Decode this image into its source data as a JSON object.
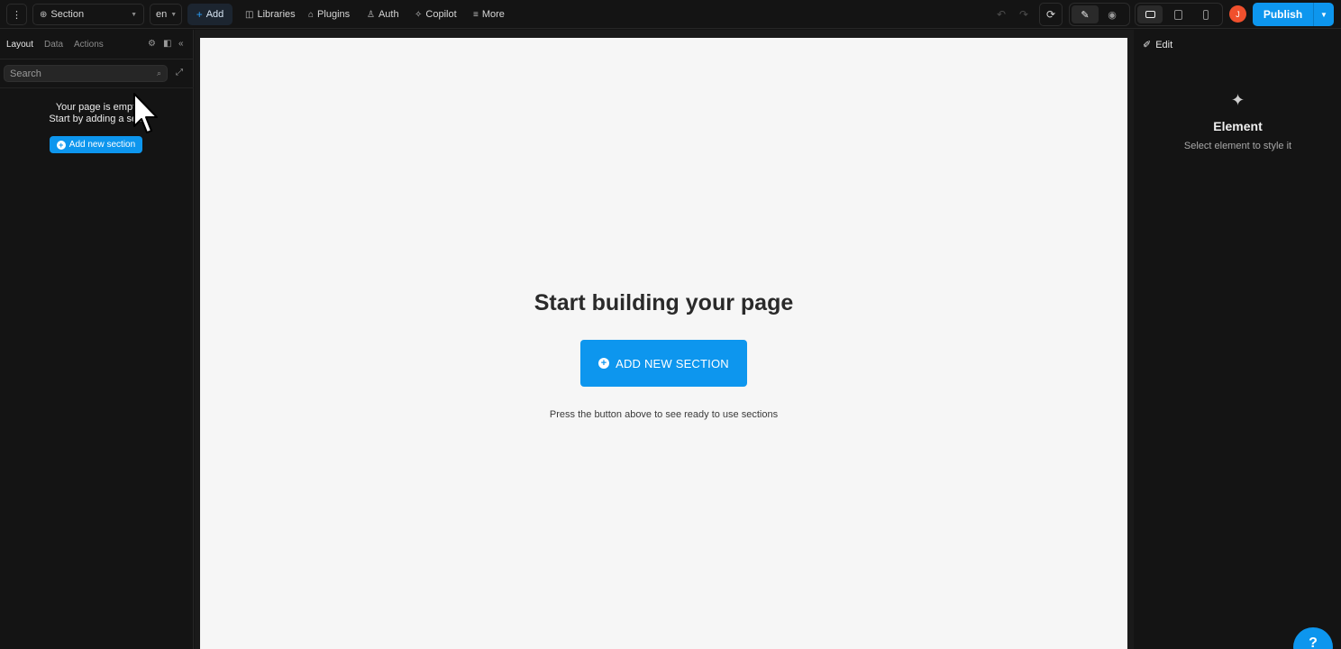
{
  "toolbar": {
    "page_select": "Section",
    "language": "en",
    "add": "Add",
    "libraries": "Libraries",
    "plugins": "Plugins",
    "auth": "Auth",
    "copilot": "Copilot",
    "more": "More",
    "avatar_initial": "J",
    "publish": "Publish"
  },
  "sidebar": {
    "tabs": [
      "Layout",
      "Data",
      "Actions"
    ],
    "search_placeholder": "Search",
    "empty_line1": "Your page is empt",
    "empty_line2": "Start by adding a sec",
    "add_section": "Add new section"
  },
  "canvas": {
    "title": "Start building your page",
    "add_button": "ADD NEW SECTION",
    "hint": "Press the button above to see ready to use sections"
  },
  "panel": {
    "edit": "Edit",
    "element_title": "Element",
    "element_sub": "Select element to style it"
  },
  "colors": {
    "accent": "#0d96ee",
    "avatar": "#f0502d",
    "canvas_page": "#f6f6f6",
    "chrome": "#141414"
  }
}
